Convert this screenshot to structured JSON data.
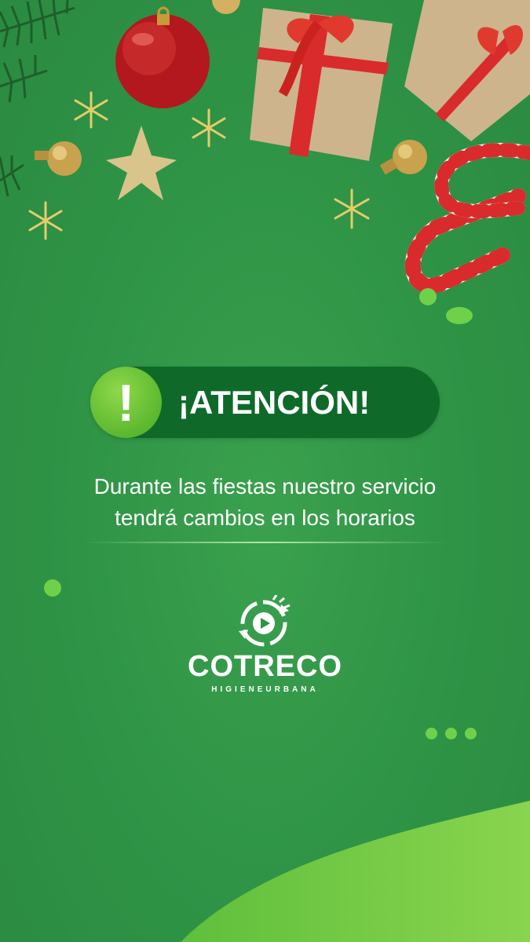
{
  "alert": {
    "title": "¡ATENCIÓN!",
    "icon": "exclamation-icon",
    "mark": "!"
  },
  "message": {
    "line1": "Durante las fiestas nuestro servicio",
    "line2": "tendrá cambios en los horarios"
  },
  "brand": {
    "name": "COTRECO",
    "tagline": "HIGIENEURBANA",
    "icon": "recycle-globe-icon"
  },
  "colors": {
    "background": "#2f9446",
    "pill": "#0f6a2a",
    "accent": "#6fd14a",
    "ribbon": "#d92b2b"
  }
}
